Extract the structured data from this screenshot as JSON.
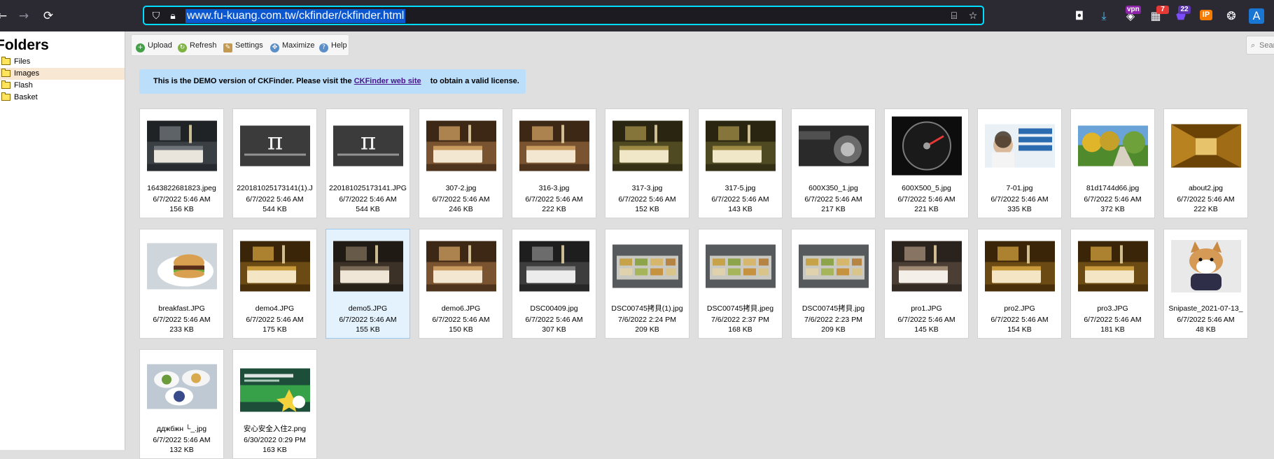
{
  "browser": {
    "url": "www.fu-kuang.com.tw/ckfinder/ckfinder.html",
    "badges": {
      "calendar": "7",
      "shield": "22",
      "vpn": "vpn",
      "ip": "IP"
    },
    "accent": "#00ddff"
  },
  "sidebar": {
    "title": "Folders",
    "items": [
      {
        "label": "Files"
      },
      {
        "label": "Images"
      },
      {
        "label": "Flash"
      },
      {
        "label": "Basket"
      }
    ]
  },
  "toolbar": {
    "upload": "Upload",
    "refresh": "Refresh",
    "settings": "Settings",
    "maximize": "Maximize",
    "help": "Help",
    "search_partial": "Sear"
  },
  "notice": {
    "before": "This is the DEMO version of CKFinder. Please visit the ",
    "link": "CKFinder web site",
    "after": " to obtain a valid license."
  },
  "files": [
    {
      "name": "1643822681823.jpeg",
      "date": "6/7/2022 5:46 AM",
      "size": "156 KB",
      "thumb": "room-dark"
    },
    {
      "name": "220181025173141(1).J",
      "date": "6/7/2022 5:46 AM",
      "size": "544 KB",
      "thumb": "pi"
    },
    {
      "name": "220181025173141.JPG",
      "date": "6/7/2022 5:46 AM",
      "size": "544 KB",
      "thumb": "pi"
    },
    {
      "name": "307-2.jpg",
      "date": "6/7/2022 5:46 AM",
      "size": "246 KB",
      "thumb": "room-warm"
    },
    {
      "name": "316-3.jpg",
      "date": "6/7/2022 5:46 AM",
      "size": "222 KB",
      "thumb": "room-warm"
    },
    {
      "name": "317-3.jpg",
      "date": "6/7/2022 5:46 AM",
      "size": "152 KB",
      "thumb": "room-green"
    },
    {
      "name": "317-5.jpg",
      "date": "6/7/2022 5:46 AM",
      "size": "143 KB",
      "thumb": "room-green"
    },
    {
      "name": "600X350_1.jpg",
      "date": "6/7/2022 5:46 AM",
      "size": "217 KB",
      "thumb": "car"
    },
    {
      "name": "600X500_5.jpg",
      "date": "6/7/2022 5:46 AM",
      "size": "221 KB",
      "thumb": "gauge"
    },
    {
      "name": "7-01.jpg",
      "date": "6/7/2022 5:46 AM",
      "size": "335 KB",
      "thumb": "banner"
    },
    {
      "name": "81d1744d66.jpg",
      "date": "6/7/2022 5:46 AM",
      "size": "372 KB",
      "thumb": "park"
    },
    {
      "name": "about2.jpg",
      "date": "6/7/2022 5:46 AM",
      "size": "222 KB",
      "thumb": "corridor"
    },
    {
      "name": "breakfast.JPG",
      "date": "6/7/2022 5:46 AM",
      "size": "233 KB",
      "thumb": "burger"
    },
    {
      "name": "demo4.JPG",
      "date": "6/7/2022 5:46 AM",
      "size": "175 KB",
      "thumb": "room-gold"
    },
    {
      "name": "demo5.JPG",
      "date": "6/7/2022 5:46 AM",
      "size": "155 KB",
      "thumb": "room-dark2"
    },
    {
      "name": "demo6.JPG",
      "date": "6/7/2022 5:46 AM",
      "size": "150 KB",
      "thumb": "room-warm"
    },
    {
      "name": "DSC00409.jpg",
      "date": "6/7/2022 5:46 AM",
      "size": "307 KB",
      "thumb": "room-grey"
    },
    {
      "name": "DSC00745拷貝(1).jpg",
      "date": "7/6/2022 2:24 PM",
      "size": "209 KB",
      "thumb": "buffet"
    },
    {
      "name": "DSC00745拷貝.jpeg",
      "date": "7/6/2022 2:37 PM",
      "size": "168 KB",
      "thumb": "buffet"
    },
    {
      "name": "DSC00745拷貝.jpg",
      "date": "7/6/2022 2:23 PM",
      "size": "209 KB",
      "thumb": "buffet"
    },
    {
      "name": "pro1.JPG",
      "date": "6/7/2022 5:46 AM",
      "size": "145 KB",
      "thumb": "room-light"
    },
    {
      "name": "pro2.JPG",
      "date": "6/7/2022 5:46 AM",
      "size": "154 KB",
      "thumb": "room-gold"
    },
    {
      "name": "pro3.JPG",
      "date": "6/7/2022 5:46 AM",
      "size": "181 KB",
      "thumb": "room-gold"
    },
    {
      "name": "Snipaste_2021-07-13_",
      "date": "6/7/2022 5:46 AM",
      "size": "48 KB",
      "thumb": "dog"
    },
    {
      "name": "дджбжн └_.jpg",
      "date": "6/7/2022 5:46 AM",
      "size": "132 KB",
      "thumb": "meal"
    },
    {
      "name": "安心安全入住2.png",
      "date": "6/30/2022 0:29 PM",
      "size": "163 KB",
      "thumb": "poster"
    }
  ],
  "selected_file": "demo5.JPG"
}
